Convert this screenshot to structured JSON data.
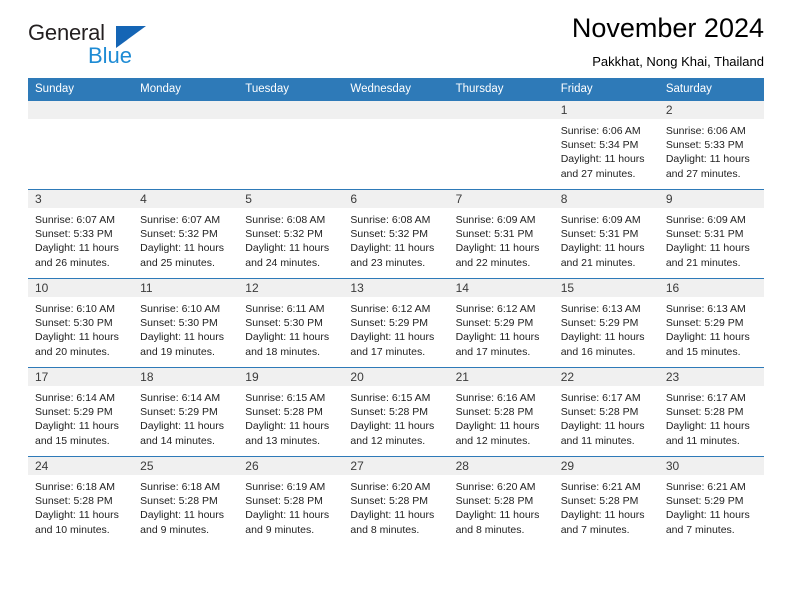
{
  "brand": {
    "name_part1": "General",
    "name_part2": "Blue",
    "triangle_color": "#1565b5",
    "blue_color": "#1e8bd4"
  },
  "header": {
    "month_title": "November 2024",
    "location": "Pakkhat, Nong Khai, Thailand"
  },
  "theme": {
    "header_bg": "#2e7ab8",
    "row_line": "#2e7ab8",
    "daynum_band": "#f0f0f0"
  },
  "calendar": {
    "weekday_headers": [
      "Sunday",
      "Monday",
      "Tuesday",
      "Wednesday",
      "Thursday",
      "Friday",
      "Saturday"
    ],
    "weeks": [
      [
        {
          "day": "",
          "empty": true
        },
        {
          "day": "",
          "empty": true
        },
        {
          "day": "",
          "empty": true
        },
        {
          "day": "",
          "empty": true
        },
        {
          "day": "",
          "empty": true
        },
        {
          "day": "1",
          "sunrise": "Sunrise: 6:06 AM",
          "sunset": "Sunset: 5:34 PM",
          "daylight": "Daylight: 11 hours and 27 minutes."
        },
        {
          "day": "2",
          "sunrise": "Sunrise: 6:06 AM",
          "sunset": "Sunset: 5:33 PM",
          "daylight": "Daylight: 11 hours and 27 minutes."
        }
      ],
      [
        {
          "day": "3",
          "sunrise": "Sunrise: 6:07 AM",
          "sunset": "Sunset: 5:33 PM",
          "daylight": "Daylight: 11 hours and 26 minutes."
        },
        {
          "day": "4",
          "sunrise": "Sunrise: 6:07 AM",
          "sunset": "Sunset: 5:32 PM",
          "daylight": "Daylight: 11 hours and 25 minutes."
        },
        {
          "day": "5",
          "sunrise": "Sunrise: 6:08 AM",
          "sunset": "Sunset: 5:32 PM",
          "daylight": "Daylight: 11 hours and 24 minutes."
        },
        {
          "day": "6",
          "sunrise": "Sunrise: 6:08 AM",
          "sunset": "Sunset: 5:32 PM",
          "daylight": "Daylight: 11 hours and 23 minutes."
        },
        {
          "day": "7",
          "sunrise": "Sunrise: 6:09 AM",
          "sunset": "Sunset: 5:31 PM",
          "daylight": "Daylight: 11 hours and 22 minutes."
        },
        {
          "day": "8",
          "sunrise": "Sunrise: 6:09 AM",
          "sunset": "Sunset: 5:31 PM",
          "daylight": "Daylight: 11 hours and 21 minutes."
        },
        {
          "day": "9",
          "sunrise": "Sunrise: 6:09 AM",
          "sunset": "Sunset: 5:31 PM",
          "daylight": "Daylight: 11 hours and 21 minutes."
        }
      ],
      [
        {
          "day": "10",
          "sunrise": "Sunrise: 6:10 AM",
          "sunset": "Sunset: 5:30 PM",
          "daylight": "Daylight: 11 hours and 20 minutes."
        },
        {
          "day": "11",
          "sunrise": "Sunrise: 6:10 AM",
          "sunset": "Sunset: 5:30 PM",
          "daylight": "Daylight: 11 hours and 19 minutes."
        },
        {
          "day": "12",
          "sunrise": "Sunrise: 6:11 AM",
          "sunset": "Sunset: 5:30 PM",
          "daylight": "Daylight: 11 hours and 18 minutes."
        },
        {
          "day": "13",
          "sunrise": "Sunrise: 6:12 AM",
          "sunset": "Sunset: 5:29 PM",
          "daylight": "Daylight: 11 hours and 17 minutes."
        },
        {
          "day": "14",
          "sunrise": "Sunrise: 6:12 AM",
          "sunset": "Sunset: 5:29 PM",
          "daylight": "Daylight: 11 hours and 17 minutes."
        },
        {
          "day": "15",
          "sunrise": "Sunrise: 6:13 AM",
          "sunset": "Sunset: 5:29 PM",
          "daylight": "Daylight: 11 hours and 16 minutes."
        },
        {
          "day": "16",
          "sunrise": "Sunrise: 6:13 AM",
          "sunset": "Sunset: 5:29 PM",
          "daylight": "Daylight: 11 hours and 15 minutes."
        }
      ],
      [
        {
          "day": "17",
          "sunrise": "Sunrise: 6:14 AM",
          "sunset": "Sunset: 5:29 PM",
          "daylight": "Daylight: 11 hours and 15 minutes."
        },
        {
          "day": "18",
          "sunrise": "Sunrise: 6:14 AM",
          "sunset": "Sunset: 5:29 PM",
          "daylight": "Daylight: 11 hours and 14 minutes."
        },
        {
          "day": "19",
          "sunrise": "Sunrise: 6:15 AM",
          "sunset": "Sunset: 5:28 PM",
          "daylight": "Daylight: 11 hours and 13 minutes."
        },
        {
          "day": "20",
          "sunrise": "Sunrise: 6:15 AM",
          "sunset": "Sunset: 5:28 PM",
          "daylight": "Daylight: 11 hours and 12 minutes."
        },
        {
          "day": "21",
          "sunrise": "Sunrise: 6:16 AM",
          "sunset": "Sunset: 5:28 PM",
          "daylight": "Daylight: 11 hours and 12 minutes."
        },
        {
          "day": "22",
          "sunrise": "Sunrise: 6:17 AM",
          "sunset": "Sunset: 5:28 PM",
          "daylight": "Daylight: 11 hours and 11 minutes."
        },
        {
          "day": "23",
          "sunrise": "Sunrise: 6:17 AM",
          "sunset": "Sunset: 5:28 PM",
          "daylight": "Daylight: 11 hours and 11 minutes."
        }
      ],
      [
        {
          "day": "24",
          "sunrise": "Sunrise: 6:18 AM",
          "sunset": "Sunset: 5:28 PM",
          "daylight": "Daylight: 11 hours and 10 minutes."
        },
        {
          "day": "25",
          "sunrise": "Sunrise: 6:18 AM",
          "sunset": "Sunset: 5:28 PM",
          "daylight": "Daylight: 11 hours and 9 minutes."
        },
        {
          "day": "26",
          "sunrise": "Sunrise: 6:19 AM",
          "sunset": "Sunset: 5:28 PM",
          "daylight": "Daylight: 11 hours and 9 minutes."
        },
        {
          "day": "27",
          "sunrise": "Sunrise: 6:20 AM",
          "sunset": "Sunset: 5:28 PM",
          "daylight": "Daylight: 11 hours and 8 minutes."
        },
        {
          "day": "28",
          "sunrise": "Sunrise: 6:20 AM",
          "sunset": "Sunset: 5:28 PM",
          "daylight": "Daylight: 11 hours and 8 minutes."
        },
        {
          "day": "29",
          "sunrise": "Sunrise: 6:21 AM",
          "sunset": "Sunset: 5:28 PM",
          "daylight": "Daylight: 11 hours and 7 minutes."
        },
        {
          "day": "30",
          "sunrise": "Sunrise: 6:21 AM",
          "sunset": "Sunset: 5:29 PM",
          "daylight": "Daylight: 11 hours and 7 minutes."
        }
      ]
    ]
  }
}
